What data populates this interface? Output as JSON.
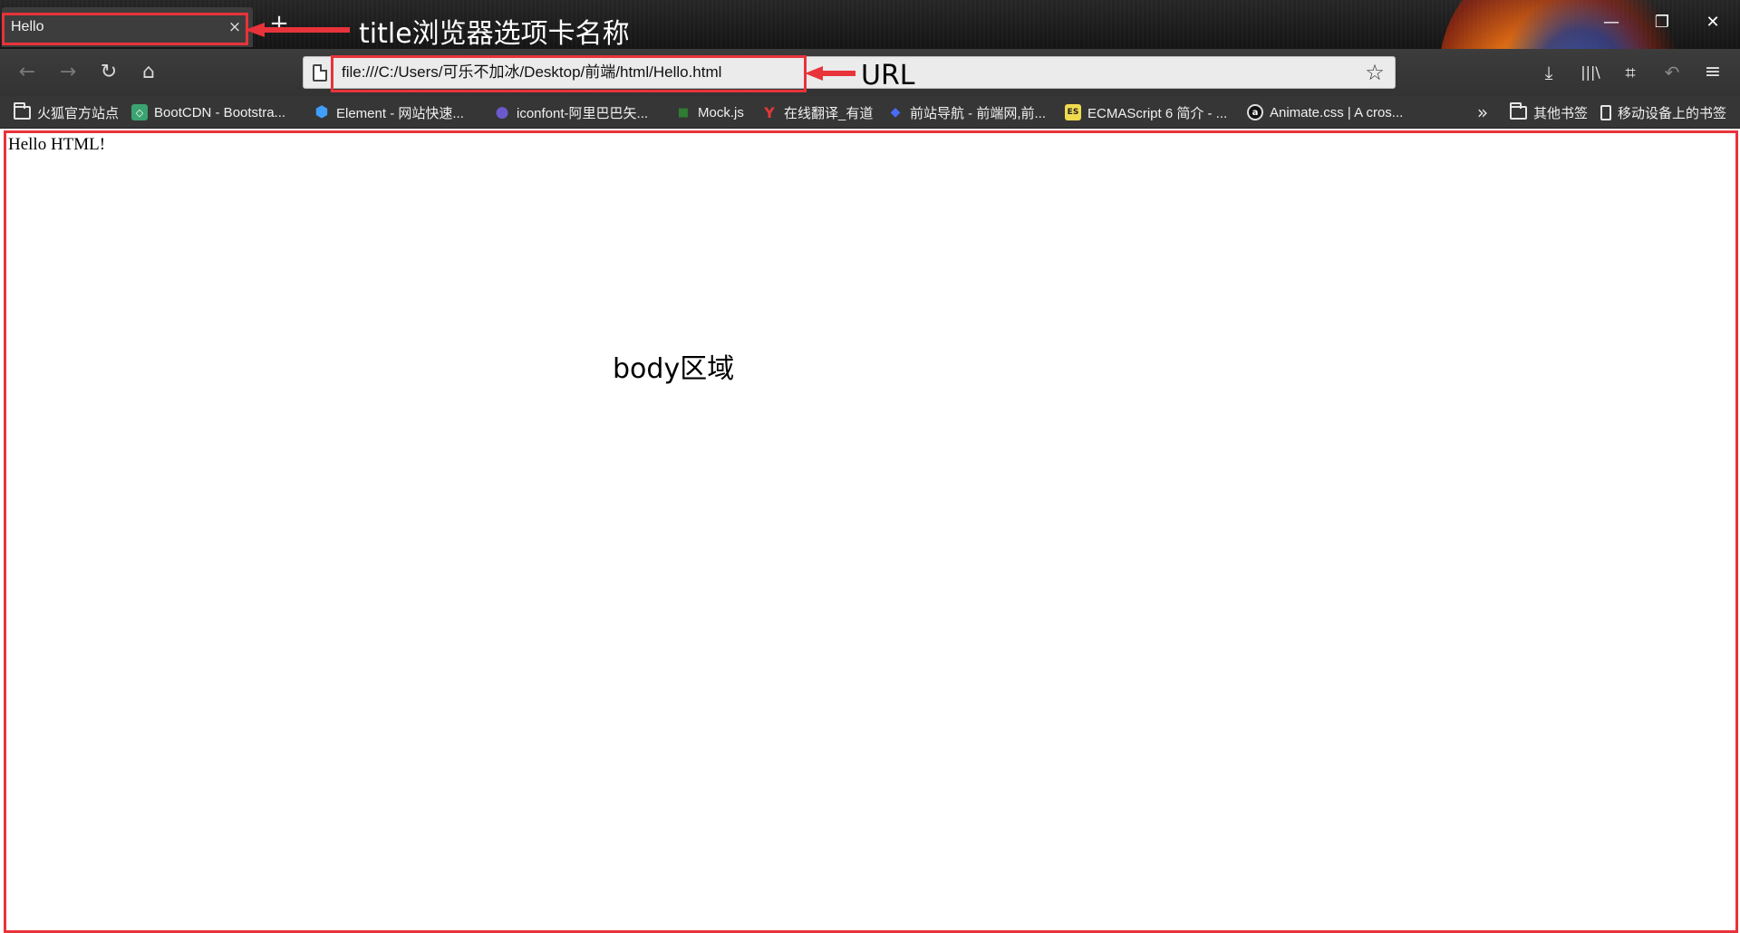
{
  "tab": {
    "title": "Hello",
    "close_glyph": "×"
  },
  "new_tab_glyph": "+",
  "window_controls": {
    "minimize": "—",
    "maximize": "❐",
    "close": "✕"
  },
  "nav": {
    "back": "←",
    "forward": "→",
    "reload": "↻",
    "home": "⌂"
  },
  "url": {
    "value": "file:///C:/Users/可乐不加冰/Desktop/前端/html/Hello.html",
    "star_glyph": "☆"
  },
  "toolbar": {
    "download": "⤓",
    "library": "|||\\",
    "screenshot": "⌗",
    "sync": "↶",
    "menu": "≡"
  },
  "bookmarks": [
    {
      "label": "火狐官方站点",
      "icon": "folder-icon"
    },
    {
      "label": "BootCDN - Bootstra...",
      "icon": "bootcdn-icon",
      "color": "#3aa36f",
      "glyph": "◇"
    },
    {
      "label": "Element - 网站快速...",
      "icon": "element-icon",
      "color": "#409eff",
      "glyph": "⬢"
    },
    {
      "label": "iconfont-阿里巴巴矢...",
      "icon": "iconfont-icon",
      "color": "#6a5acd",
      "glyph": "●"
    },
    {
      "label": "Mock.js",
      "icon": "mockjs-icon",
      "color": "#2e7d32",
      "glyph": "■"
    },
    {
      "label": "在线翻译_有道",
      "icon": "youdao-icon",
      "color": "#e53935",
      "glyph": "Y"
    },
    {
      "label": "前站导航 - 前端网,前...",
      "icon": "nav-icon",
      "color": "#4a6cf7",
      "glyph": "◆"
    },
    {
      "label": "ECMAScript 6 简介 - ...",
      "icon": "es-icon",
      "color": "#f0db4f",
      "glyph": "ES"
    },
    {
      "label": "Animate.css | A cros...",
      "icon": "animate-icon",
      "color": "#111111",
      "glyph": "a"
    }
  ],
  "bookmarks_overflow": "»",
  "other_bookmarks": {
    "label": "其他书签",
    "icon": "folder-icon"
  },
  "mobile_bookmarks": {
    "label": "移动设备上的书签",
    "icon": "mobile-icon"
  },
  "page": {
    "text": "Hello HTML!"
  },
  "annotations": {
    "title_label": "title浏览器选项卡名称",
    "url_label": "URL",
    "body_label": "body区域",
    "color": "#e8333a"
  }
}
